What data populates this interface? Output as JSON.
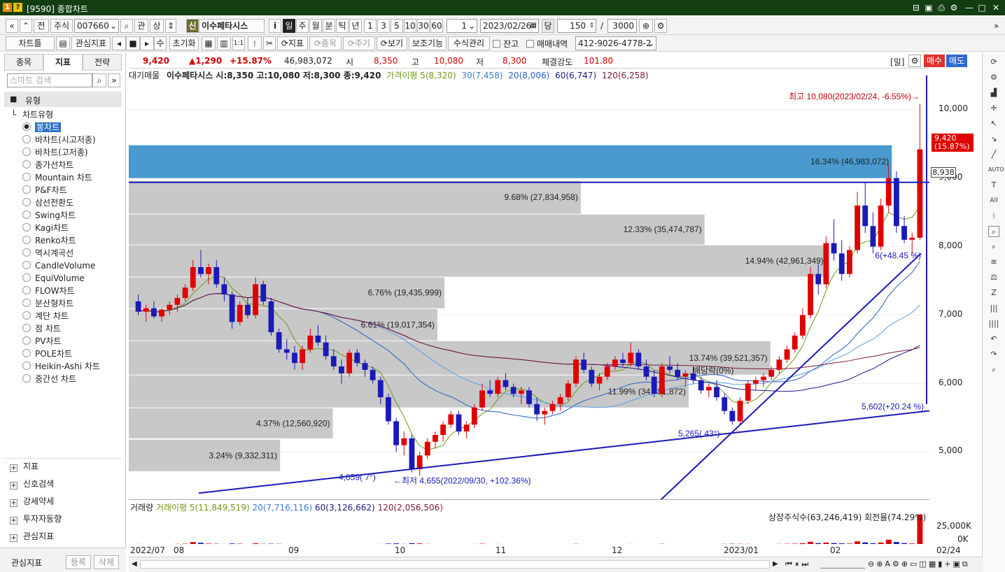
{
  "window": {
    "title": "[9590] 종합차트",
    "badge1": "1",
    "badge2": "?"
  },
  "toolbar1": {
    "nav_back": "«",
    "nav_up": "»",
    "prev": "전",
    "market": "주식",
    "code": "007660",
    "search_icon": "search-icon",
    "gwan": "관",
    "sang": "상",
    "credit": "신",
    "name": "이수페타시스",
    "info": "i",
    "periods": [
      "일",
      "주",
      "월",
      "분",
      "틱",
      "년"
    ],
    "period_sel": "일",
    "mins": [
      "1",
      "3",
      "5",
      "10",
      "30",
      "60"
    ],
    "mins_select": "1",
    "date": "2023/02/26",
    "dang": "당",
    "count": "150",
    "slash": "/",
    "max": "3000"
  },
  "toolbar2": {
    "chart_type": "차트틀",
    "watch": "관심지표",
    "su": "수",
    "init": "초기화",
    "indicator": "지표",
    "item": "종목",
    "period": "주기",
    "view": "보기",
    "aux": "보조기능",
    "formula": "수식관리",
    "balance": "잔고",
    "trades": "매매내역",
    "account": "412-9026-4778-2"
  },
  "quote": {
    "price": "9,420",
    "change": "▲1,290",
    "pct": "+15.87%",
    "volume": "46,983,072",
    "open_l": "시",
    "open": "8,350",
    "high_l": "고",
    "high": "10,080",
    "low_l": "저",
    "low": "8,300",
    "strength_l": "체결강도",
    "strength": "101.80",
    "day": "[일]",
    "buy": "매수",
    "sell": "매도"
  },
  "left": {
    "tabs": [
      "종목",
      "지표",
      "전략"
    ],
    "tab_sel": "지표",
    "search_placeholder": "스마트 검색",
    "category": "유형",
    "group": "차트유형",
    "types": [
      "봉차트",
      "바차트(시고저종)",
      "바차트(고저종)",
      "종가선차트",
      "Mountain 차트",
      "P&F차트",
      "삼선전환도",
      "Swing차트",
      "Kagi차트",
      "Renko차트",
      "역시계곡선",
      "CandleVolume",
      "EquiVolume",
      "FLOW차트",
      "분산형차트",
      "계단 차트",
      "점 차트",
      "PV차트",
      "POLE차트",
      "Heikin-Ashi 차트",
      "중간선 차트"
    ],
    "selected_type": "봉차트",
    "groups": [
      "지표",
      "신호검색",
      "강세약세",
      "투자자동향",
      "관심지표"
    ],
    "footer_label": "관심지표",
    "register": "등록",
    "delete": "삭제"
  },
  "legend": {
    "volprofile": "대기매물",
    "stock": "이수페타시스 시:8,350 고:10,080 저:8,300 종:9,420",
    "ma5": "가격이평 5(8,320)",
    "ma30": "30(7,458)",
    "ma20": "20(8,006)",
    "ma60": "60(6,747)",
    "ma120": "120(6,258)",
    "colors": {
      "ma5": "#6a9a1a",
      "ma30": "#3a7fd6",
      "ma20": "#3a7fd6",
      "ma60": "#1a1a8a",
      "ma120": "#7a1a3a"
    }
  },
  "annotations": {
    "high": "최고 10,080(2023/02/24, -6.55%)→",
    "low": "←최저 4,655(2022/09/30, +102.36%)",
    "current_tag1": "9,420",
    "current_tag2": "(15.87%)",
    "line_tag": "8,938",
    "ann1": "4,659( 7°)",
    "ann2": "5,265( 43°)",
    "ann3": "5,602(+20.24 %)",
    "ann4": "6(+48.45 %)",
    "ann5": "배당락(0%)"
  },
  "chart_data": {
    "type": "candlestick",
    "title": "이수페타시스",
    "y_ticks": [
      "10,000",
      "9,000",
      "8,000",
      "7,000",
      "6,000",
      "5,000"
    ],
    "y_range": [
      4300,
      10600
    ],
    "x_ticks": [
      "2022/07",
      "08",
      "09",
      "10",
      "11",
      "12",
      "2023/01",
      "02"
    ],
    "x_last": "02/24",
    "volume_profile": [
      {
        "pct": "16.34%",
        "vol": "46,983,072",
        "lo": 9000,
        "hi": 9480
      },
      {
        "pct": "9.68%",
        "vol": "27,834,958",
        "lo": 8480,
        "hi": 8960
      },
      {
        "pct": "12.33%",
        "vol": "35,474,787",
        "lo": 8030,
        "hi": 8470
      },
      {
        "pct": "14.94%",
        "vol": "42,961,349",
        "lo": 7560,
        "hi": 8020
      },
      {
        "pct": "6.76%",
        "vol": "19,435,999",
        "lo": 7100,
        "hi": 7550
      },
      {
        "pct": "6.61%",
        "vol": "19,017,354",
        "lo": 6630,
        "hi": 7090
      },
      {
        "pct": "13.74%",
        "vol": "39,521,357",
        "lo": 6130,
        "hi": 6620
      },
      {
        "pct": "11.99%",
        "vol": "34,481,872",
        "lo": 5650,
        "hi": 6120
      },
      {
        "pct": "4.37%",
        "vol": "12,560,920",
        "lo": 5200,
        "hi": 5640
      },
      {
        "pct": "3.24%",
        "vol": "9,332,311",
        "lo": 4720,
        "hi": 5180
      }
    ],
    "vp_max_pct": 16.34,
    "ohlc": [
      [
        7200,
        7300,
        7000,
        7050
      ],
      [
        7050,
        7150,
        6900,
        7100
      ],
      [
        7100,
        7200,
        6950,
        6980
      ],
      [
        6980,
        7100,
        6900,
        7080
      ],
      [
        7080,
        7200,
        7000,
        7150
      ],
      [
        7150,
        7300,
        7050,
        7250
      ],
      [
        7250,
        7450,
        7200,
        7400
      ],
      [
        7400,
        7800,
        7350,
        7700
      ],
      [
        7700,
        7950,
        7550,
        7600
      ],
      [
        7600,
        7750,
        7450,
        7700
      ],
      [
        7700,
        7800,
        7400,
        7450
      ],
      [
        7450,
        7550,
        7200,
        7300
      ],
      [
        7300,
        7350,
        6800,
        6900
      ],
      [
        6900,
        7200,
        6850,
        7150
      ],
      [
        7150,
        7250,
        6950,
        7000
      ],
      [
        7000,
        7550,
        6950,
        7450
      ],
      [
        7450,
        7500,
        7150,
        7200
      ],
      [
        7200,
        7250,
        6700,
        6750
      ],
      [
        6750,
        6800,
        6450,
        6500
      ],
      [
        6500,
        6650,
        6350,
        6450
      ],
      [
        6450,
        6550,
        6200,
        6300
      ],
      [
        6300,
        6550,
        6200,
        6500
      ],
      [
        6500,
        6800,
        6450,
        6700
      ],
      [
        6700,
        6850,
        6550,
        6600
      ],
      [
        6600,
        6700,
        6350,
        6400
      ],
      [
        6400,
        6500,
        6200,
        6250
      ],
      [
        6250,
        6350,
        6000,
        6150
      ],
      [
        6150,
        6500,
        6100,
        6450
      ],
      [
        6450,
        6500,
        6250,
        6300
      ],
      [
        6300,
        6350,
        6100,
        6200
      ],
      [
        6200,
        6250,
        6000,
        6050
      ],
      [
        6050,
        6100,
        5700,
        5800
      ],
      [
        5800,
        5850,
        5400,
        5450
      ],
      [
        5450,
        5500,
        5000,
        5100
      ],
      [
        5100,
        5300,
        4950,
        5200
      ],
      [
        5200,
        5250,
        4700,
        4750
      ],
      [
        4750,
        5000,
        4655,
        4950
      ],
      [
        4950,
        5200,
        4900,
        5150
      ],
      [
        5150,
        5300,
        5050,
        5250
      ],
      [
        5250,
        5450,
        5150,
        5400
      ],
      [
        5400,
        5600,
        5350,
        5550
      ],
      [
        5550,
        5600,
        5250,
        5300
      ],
      [
        5300,
        5450,
        5200,
        5400
      ],
      [
        5400,
        5700,
        5350,
        5650
      ],
      [
        5650,
        6000,
        5600,
        5900
      ],
      [
        5900,
        6050,
        5800,
        5850
      ],
      [
        5850,
        6100,
        5800,
        6050
      ],
      [
        6050,
        6150,
        5900,
        5950
      ],
      [
        5950,
        6000,
        5800,
        5850
      ],
      [
        5850,
        5950,
        5700,
        5900
      ],
      [
        5900,
        5950,
        5650,
        5700
      ],
      [
        5700,
        5800,
        5450,
        5550
      ],
      [
        5550,
        5650,
        5400,
        5600
      ],
      [
        5600,
        5750,
        5550,
        5700
      ],
      [
        5700,
        5850,
        5600,
        5800
      ],
      [
        5800,
        6050,
        5750,
        6000
      ],
      [
        6000,
        6400,
        5950,
        6350
      ],
      [
        6350,
        6450,
        6150,
        6200
      ],
      [
        6200,
        6250,
        5950,
        6000
      ],
      [
        6000,
        6150,
        5900,
        6100
      ],
      [
        6100,
        6300,
        6050,
        6250
      ],
      [
        6250,
        6400,
        6200,
        6350
      ],
      [
        6350,
        6450,
        6250,
        6300
      ],
      [
        6300,
        6600,
        6250,
        6450
      ],
      [
        6450,
        6500,
        6200,
        6250
      ],
      [
        6250,
        6350,
        6050,
        6100
      ],
      [
        6100,
        6200,
        5800,
        5850
      ],
      [
        5850,
        6300,
        5800,
        6250
      ],
      [
        6250,
        6400,
        6150,
        6200
      ],
      [
        6200,
        6300,
        6050,
        6100
      ],
      [
        6100,
        6200,
        5950,
        6150
      ],
      [
        6150,
        6250,
        6000,
        6050
      ],
      [
        6050,
        6100,
        5850,
        5900
      ],
      [
        5900,
        6000,
        5800,
        5950
      ],
      [
        5950,
        6050,
        5750,
        5800
      ],
      [
        5800,
        5850,
        5550,
        5600
      ],
      [
        5600,
        5650,
        5400,
        5450
      ],
      [
        5450,
        5800,
        5400,
        5750
      ],
      [
        5750,
        6050,
        5700,
        6000
      ],
      [
        6000,
        6100,
        5900,
        6050
      ],
      [
        6050,
        6150,
        5950,
        6100
      ],
      [
        6100,
        6250,
        6050,
        6200
      ],
      [
        6200,
        6400,
        6150,
        6350
      ],
      [
        6350,
        6550,
        6300,
        6500
      ],
      [
        6500,
        6750,
        6450,
        6700
      ],
      [
        6700,
        7100,
        6650,
        7000
      ],
      [
        7000,
        7700,
        6950,
        7600
      ],
      [
        7600,
        7750,
        7300,
        7450
      ],
      [
        7450,
        8150,
        7400,
        8050
      ],
      [
        8050,
        8400,
        7800,
        7900
      ],
      [
        7900,
        8100,
        7500,
        7600
      ],
      [
        7600,
        8000,
        7550,
        7950
      ],
      [
        7950,
        8800,
        7900,
        8600
      ],
      [
        8600,
        8950,
        8200,
        8300
      ],
      [
        8300,
        8500,
        7900,
        8000
      ],
      [
        8000,
        8700,
        7950,
        8600
      ],
      [
        8600,
        9200,
        8500,
        9000
      ],
      [
        9000,
        9100,
        8200,
        8300
      ],
      [
        8300,
        8450,
        8050,
        8100
      ],
      [
        8100,
        8200,
        7900,
        8130
      ],
      [
        8130,
        10080,
        8100,
        9420
      ]
    ],
    "volumes": [
      1.2,
      0.9,
      0.8,
      0.7,
      0.9,
      1.3,
      1.6,
      4.1,
      3.0,
      1.8,
      1.5,
      1.2,
      2.0,
      1.6,
      1.0,
      2.2,
      1.4,
      1.6,
      1.4,
      1.0,
      0.9,
      0.8,
      1.1,
      0.9,
      0.8,
      0.7,
      0.9,
      0.9,
      0.6,
      0.6,
      0.7,
      1.2,
      1.8,
      2.1,
      1.3,
      2.4,
      2.0,
      1.3,
      1.0,
      1.1,
      1.0,
      0.9,
      0.8,
      1.2,
      1.6,
      1.0,
      1.2,
      0.9,
      0.7,
      0.6,
      0.8,
      1.0,
      0.7,
      0.6,
      0.7,
      0.9,
      1.4,
      1.1,
      0.9,
      0.7,
      0.8,
      0.9,
      0.7,
      1.2,
      0.9,
      0.7,
      1.1,
      1.4,
      0.9,
      0.7,
      0.6,
      0.6,
      0.7,
      0.6,
      0.8,
      1.3,
      1.5,
      1.4,
      1.3,
      0.9,
      0.8,
      1.0,
      1.3,
      1.5,
      1.7,
      2.3,
      4.6,
      2.5,
      3.4,
      2.6,
      2.2,
      1.9,
      5.2,
      3.6,
      2.3,
      3.4,
      7.8,
      4.2,
      2.6,
      2.0,
      46.98
    ],
    "volume_legend": {
      "label": "거래량",
      "ma5": "거래이평 5(11,849,519)",
      "ma20": "20(7,716,116)",
      "ma60": "60(3,126,662)",
      "ma120": "120(2,056,506)",
      "listed": "상장주식수(63,246,419) 회전율(74.29%)",
      "ticks": [
        "25,000K",
        "0K"
      ]
    }
  }
}
